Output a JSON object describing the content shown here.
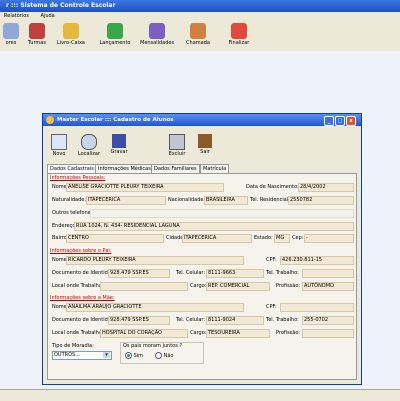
{
  "app": {
    "title": "r  :::  Sistema de Controle Escolar",
    "menu": [
      "Relatórios",
      "Ajuda"
    ],
    "toolbar": [
      "ores",
      "Turmas",
      "Livro-Caixa",
      "Lançamento",
      "Mensalidades",
      "Chamada",
      "Finalizar"
    ]
  },
  "window": {
    "title": "Master Escolar  :::  Cadastro de Alunos",
    "toolbar": [
      "Novo",
      "Localizar",
      "Gravar",
      "Excluir",
      "Sair"
    ],
    "tabs": [
      "Dados Cadastrais",
      "Informações Médicas",
      "Dados Familiares",
      "Matrícula"
    ]
  },
  "pessoal": {
    "header": "Informações Pessoais:",
    "nome_label": "Nome:",
    "nome": "ANELISE GRACIOTTE PLEURY TEIXEIRA",
    "nasc_label": "Data de Nascimento:",
    "nasc": "28/4/2002",
    "natur_label": "Naturalidade:",
    "natur": "ITAPECERICA",
    "nacion_label": "Nacionalidade:",
    "nacion": "BRASILEIRA",
    "telres_label": "Tel. Residencial:",
    "telres": "2550782",
    "outros_label": "Outros telefones:",
    "end_label": "Endereço:",
    "end": "RUA 1024, N. 434- RESIDENCIAL LAGUNA",
    "bairro_label": "Bairro:",
    "bairro": "CENTRO",
    "cidade_label": "Cidade:",
    "cidade": "ITAPECERICA",
    "estado_label": "Estado:",
    "estado": "MG",
    "cep_label": "Cep:",
    "cep": "  -"
  },
  "pai": {
    "header": "Informações sobre o Pai:",
    "nome_label": "Nome:",
    "nome": "RICARDO PLEURY TEIXEIRA",
    "cpf_label": "CPF:",
    "cpf": "426.230.811-15",
    "doc_label": "Documento de Identidade:",
    "doc": "928.479 SSP.ES",
    "cel_label": "Tel. Celular:",
    "cel": "8111-9663",
    "tt_label": "Tel. Trabalho:",
    "tt": "",
    "local_label": "Local onde Trabalha:",
    "local": "",
    "cargo_label": "Cargo:",
    "cargo": "REP. COMERCIAL",
    "prof_label": "Profissão:",
    "prof": "AUTÔNOMO"
  },
  "mae": {
    "header": "Informações sobre a Mãe:",
    "nome_label": "Nome:",
    "nome": "ANAILMA ARAUJO GRACIOTTE",
    "cpf_label": "CPF:",
    "cpf": "",
    "doc_label": "Documento de Identidade:",
    "doc": "928.479 SSP.ES",
    "cel_label": "Tel. Celular:",
    "cel": "8111-9024",
    "tt_label": "Tel. Trabalho:",
    "tt": "255-0702",
    "local_label": "Local onde Trabalha:",
    "local": "HOSPITAL DO CORAÇÃO",
    "cargo_label": "Cargo:",
    "cargo": "TESOUREIRA",
    "prof_label": "Profissão:",
    "prof": ""
  },
  "moradia": {
    "tipo_label": "Tipo de Moradia:",
    "tipo": "OUTROS...",
    "pais_label": "Os pais moram juntos ?",
    "sim": "Sim",
    "nao": "Não"
  },
  "colors": {
    "title_bar": "#2256d0",
    "section_header": "#c00000",
    "field_bg": "#f2e8d6"
  }
}
